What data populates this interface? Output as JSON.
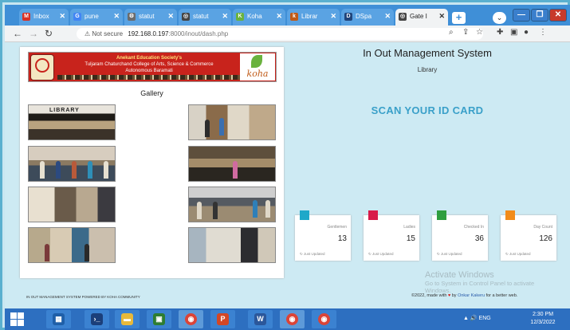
{
  "browser": {
    "tabs": [
      {
        "label": "Inbox",
        "favicon": "M",
        "favicon_color": "#d93025"
      },
      {
        "label": "pune",
        "favicon": "G",
        "favicon_color": "#4285f4"
      },
      {
        "label": "statut",
        "favicon": "⚙",
        "favicon_color": "#6b6b6b"
      },
      {
        "label": "statut",
        "favicon": "◎",
        "favicon_color": "#444444"
      },
      {
        "label": "Koha",
        "favicon": "K",
        "favicon_color": "#6ab23e"
      },
      {
        "label": "Librar",
        "favicon": "k",
        "favicon_color": "#c05a17"
      },
      {
        "label": "DSpa",
        "favicon": "D",
        "favicon_color": "#20447a"
      },
      {
        "label": "Gate I",
        "favicon": "◎",
        "favicon_color": "#444444"
      }
    ],
    "new_tab_symbol": "+",
    "url_warning": "⚠ Not secure",
    "url_host": "192.168.0.197",
    "url_path": ":8000/inout/dash.php"
  },
  "page": {
    "banner": {
      "line1": "Anekant Education Society's",
      "line2": "Tuljaram Chaturchand College of Arts, Science & Commerce",
      "line3": "Autonomous Baramati",
      "koha_label": "koha"
    },
    "gallery_title": "Gallery",
    "library_sign": "LIBRARY",
    "title": "In Out Management System",
    "subtitle": "Library",
    "scan_prompt": "SCAN YOUR ID CARD",
    "stats": [
      {
        "label": "Gentlemen",
        "value": "13",
        "updated": "↻ Just Updated",
        "color": "#1fa8c9"
      },
      {
        "label": "Ladies",
        "value": "15",
        "updated": "↻ Just Updated",
        "color": "#d81b4a"
      },
      {
        "label": "Checked In",
        "value": "36",
        "updated": "↻ Just Updated",
        "color": "#2e9e3f"
      },
      {
        "label": "Day Count",
        "value": "126",
        "updated": "↻ Just Updated",
        "color": "#f28c1a"
      }
    ],
    "footer_left": "IN OUT MANAGEMENT SYSTEM        POWERED BY KOHA COMMUNITY",
    "footer_right_prefix": "©2022, made with",
    "footer_heart": "♥",
    "footer_by": "by",
    "footer_author": "Onkar Kakeru",
    "footer_suffix": "for a better web.",
    "activate_title": "Activate Windows",
    "activate_sub": "Go to System in Control Panel to activate Windows."
  },
  "taskbar": {
    "tray": "▲ 🔊 ENG",
    "time": "2:30 PM",
    "date": "12/3/2022"
  }
}
